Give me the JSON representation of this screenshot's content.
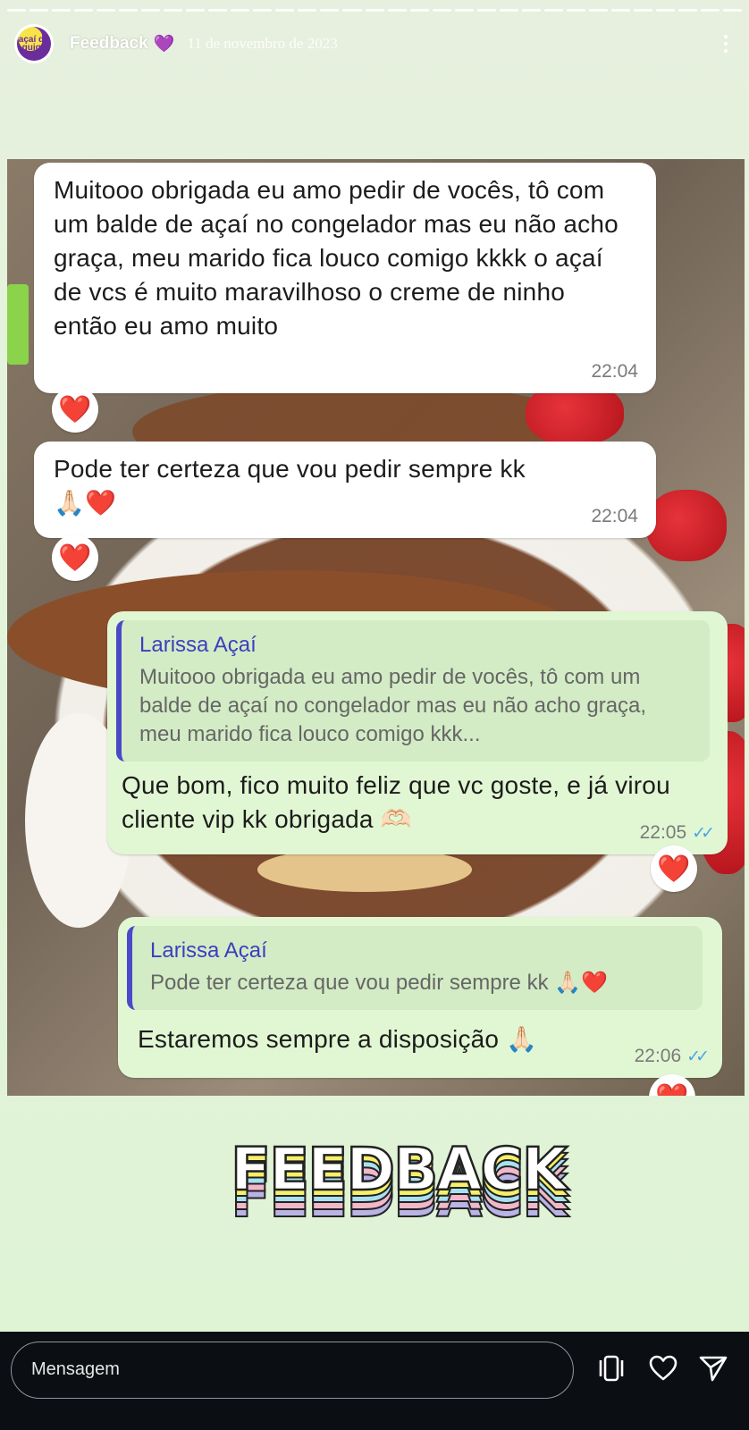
{
  "story": {
    "username": "Feedback",
    "username_emoji": "💜",
    "date": "11 de novembro de 2023",
    "avatar_icon": "acai-logo-icon",
    "avatar_text": "açaí do guiga"
  },
  "chat": {
    "messages": [
      {
        "text": "Muitooo obrigada eu amo pedir de vocês, tô com um balde de açaí no congelador mas eu não acho graça, meu marido fica louco comigo kkkk o açaí de vcs é muito maravilhoso o creme de ninho então eu amo muito",
        "time": "22:04",
        "reaction": "❤️"
      },
      {
        "text": "Pode ter certeza que vou pedir sempre kk 🙏🏻❤️",
        "time": "22:04",
        "reaction": "❤️"
      },
      {
        "quote_author": "Larissa Açaí",
        "quote_text": "Muitooo obrigada eu amo pedir de vocês, tô com um balde de açaí no congelador mas eu não acho graça, meu marido fica louco comigo kkk...",
        "text": "Que bom, fico muito feliz que vc goste, e já virou cliente vip kk obrigada 🫶🏻",
        "time": "22:05",
        "ticks": "✓✓",
        "reaction": "❤️"
      },
      {
        "quote_author": "Larissa Açaí",
        "quote_text": "Pode ter certeza que vou pedir sempre kk 🙏🏻❤️",
        "text": "Estaremos sempre a disposição 🙏🏻",
        "time": "22:06",
        "ticks": "✓✓",
        "reaction": "❤️"
      }
    ]
  },
  "sticker": {
    "text": "FEEDBACK",
    "colors": [
      "#b9b3e6",
      "#f2b7c9",
      "#a8e0f0",
      "#f6ef6a",
      "#ffffff"
    ]
  },
  "footer": {
    "message_placeholder": "Mensagem",
    "icons": [
      "copy-icon",
      "heart-icon",
      "send-icon"
    ]
  },
  "colors": {
    "incoming_bubble": "#ffffff",
    "outgoing_bubble": "#e1f7d3",
    "quote_bar": "#4a49c9",
    "read_ticks": "#4fa3e8",
    "reaction_heart": "#e21b2c"
  }
}
